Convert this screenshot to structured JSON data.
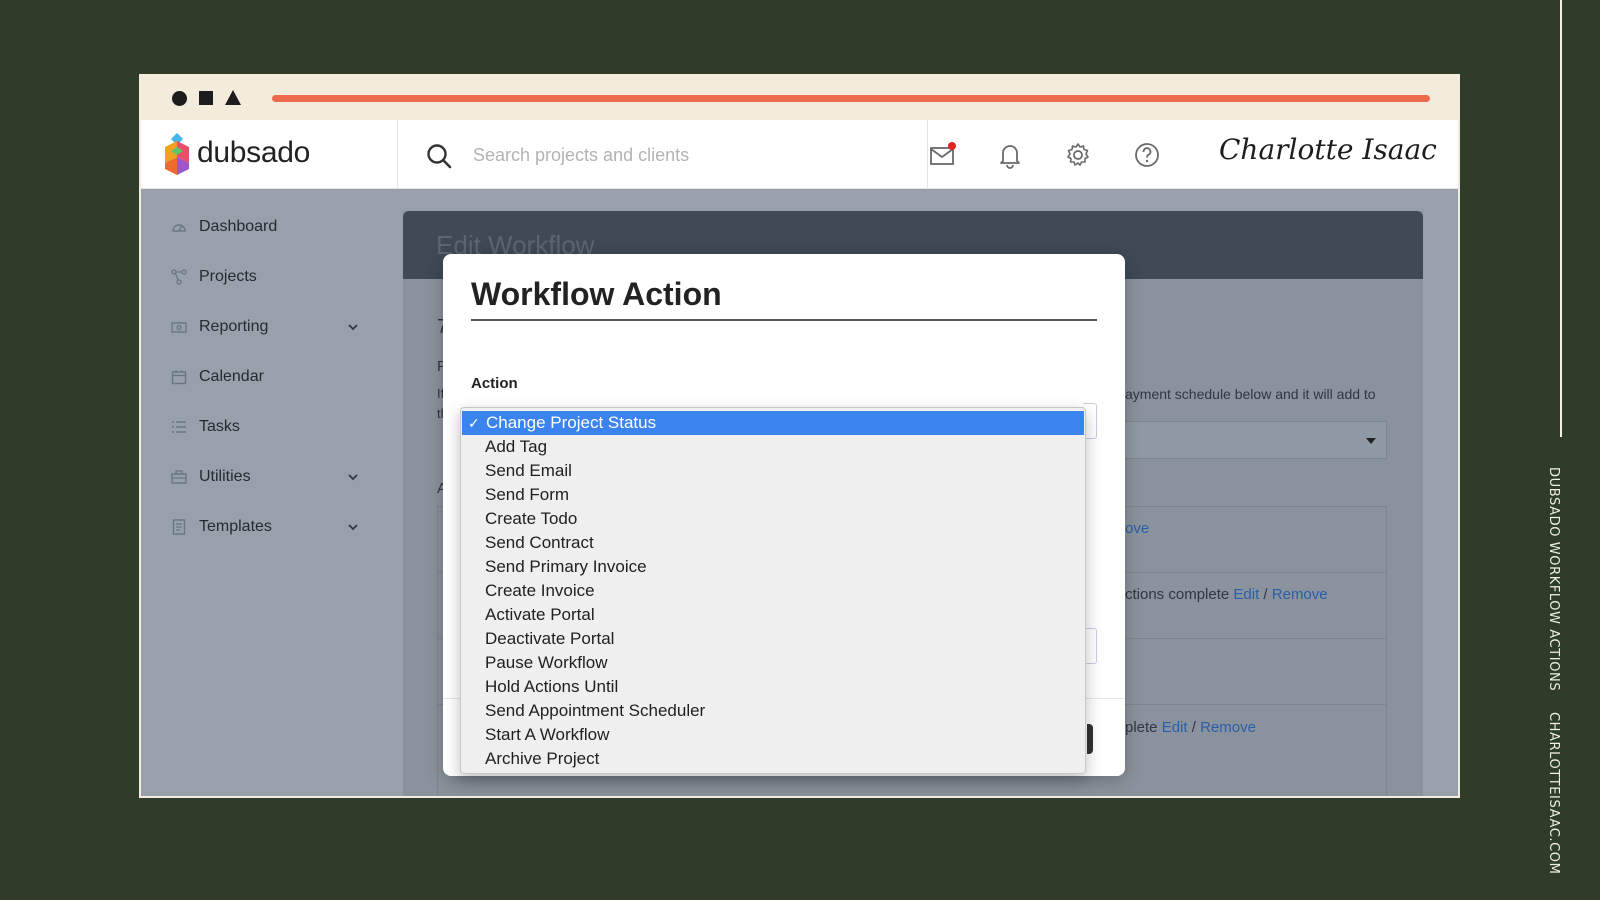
{
  "side_caption": {
    "part1": "DUBSADO WORKFLOW ACTIONS",
    "part2": "CHARLOTTEISAAC.COM"
  },
  "colors": {
    "background": "#2e3c29",
    "frame": "#f3ecdd",
    "progress_bar": "#ef6a4a",
    "selected_option": "#3b84ef"
  },
  "header": {
    "logo_text": "dubsado",
    "search_placeholder": "Search projects and clients",
    "icons": [
      "mail-icon",
      "bell-icon",
      "gear-icon",
      "help-icon"
    ],
    "signature": "Charlotte Isaac"
  },
  "sidebar": {
    "items": [
      {
        "label": "Dashboard",
        "icon": "dashboard-icon",
        "has_chevron": false
      },
      {
        "label": "Projects",
        "icon": "projects-icon",
        "has_chevron": false
      },
      {
        "label": "Reporting",
        "icon": "reporting-icon",
        "has_chevron": true
      },
      {
        "label": "Calendar",
        "icon": "calendar-icon",
        "has_chevron": false
      },
      {
        "label": "Tasks",
        "icon": "tasks-icon",
        "has_chevron": false
      },
      {
        "label": "Utilities",
        "icon": "utilities-icon",
        "has_chevron": true
      },
      {
        "label": "Templates",
        "icon": "templates-icon",
        "has_chevron": true
      }
    ]
  },
  "main": {
    "title": "Edit Workflow",
    "fragments": {
      "payment_text": "ayment schedule below and it will add to",
      "row1_link": "ove",
      "row2_text": "ctions complete",
      "row4_text": "plete",
      "edit": "Edit",
      "slash": "/",
      "remove": "Remove",
      "letter_7": "7",
      "letter_P": "P",
      "letter_If": "If",
      "letter_th": "th",
      "letter_A": "A"
    }
  },
  "modal": {
    "title": "Workflow Action",
    "action_label": "Action",
    "selected": "Change Project Status",
    "options": [
      "Change Project Status",
      "Add Tag",
      "Send Email",
      "Send Form",
      "Create Todo",
      "Send Contract",
      "Send Primary Invoice",
      "Create Invoice",
      "Activate Portal",
      "Deactivate Portal",
      "Pause Workflow",
      "Hold Actions Until",
      "Send Appointment Scheduler",
      "Start A Workflow",
      "Archive Project"
    ]
  }
}
